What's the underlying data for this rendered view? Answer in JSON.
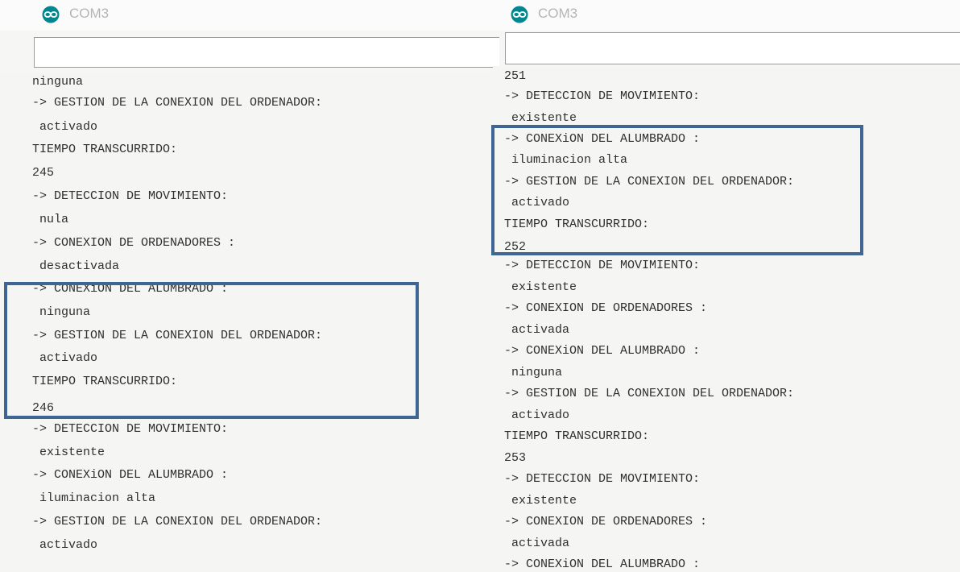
{
  "windows": {
    "left": {
      "title": "COM3",
      "input_value": "",
      "lines": [
        "ninguna",
        "-> GESTION DE LA CONEXION DEL ORDENADOR:",
        " activado",
        "TIEMPO TRANSCURRIDO:",
        "245",
        "-> DETECCION DE MOVIMIENTO:",
        " nula",
        "-> CONEXION DE ORDENADORES :",
        " desactivada",
        "-> CONEXiON DEL ALUMBRADO :",
        " ninguna",
        "-> GESTION DE LA CONEXION DEL ORDENADOR:",
        " activado",
        "TIEMPO TRANSCURRIDO:",
        "246",
        "-> DETECCION DE MOVIMIENTO:",
        " existente",
        "-> CONEXiON DEL ALUMBRADO :",
        " iluminacion alta",
        "-> GESTION DE LA CONEXION DEL ORDENADOR:",
        " activado"
      ]
    },
    "right": {
      "title": "COM3",
      "input_value": "",
      "lines": [
        "251",
        "-> DETECCION DE MOVIMIENTO:",
        " existente",
        "-> CONEXiON DEL ALUMBRADO :",
        " iluminacion alta",
        "-> GESTION DE LA CONEXION DEL ORDENADOR:",
        " activado",
        "TIEMPO TRANSCURRIDO:",
        "252",
        "-> DETECCION DE MOVIMIENTO:",
        " existente",
        "-> CONEXION DE ORDENADORES :",
        " activada",
        "-> CONEXiON DEL ALUMBRADO :",
        " ninguna",
        "-> GESTION DE LA CONEXION DEL ORDENADOR:",
        " activado",
        "TIEMPO TRANSCURRIDO:",
        "253",
        "-> DETECCION DE MOVIMIENTO:",
        " existente",
        "-> CONEXION DE ORDENADORES :",
        " activada",
        "-> CONEXiON DEL ALUMBRADO :"
      ]
    }
  },
  "colors": {
    "highlight_border": "#3e6594",
    "logo": "#00878f",
    "text": "#2f2f2f"
  },
  "icons": {
    "app_logo": "arduino-logo-icon"
  }
}
